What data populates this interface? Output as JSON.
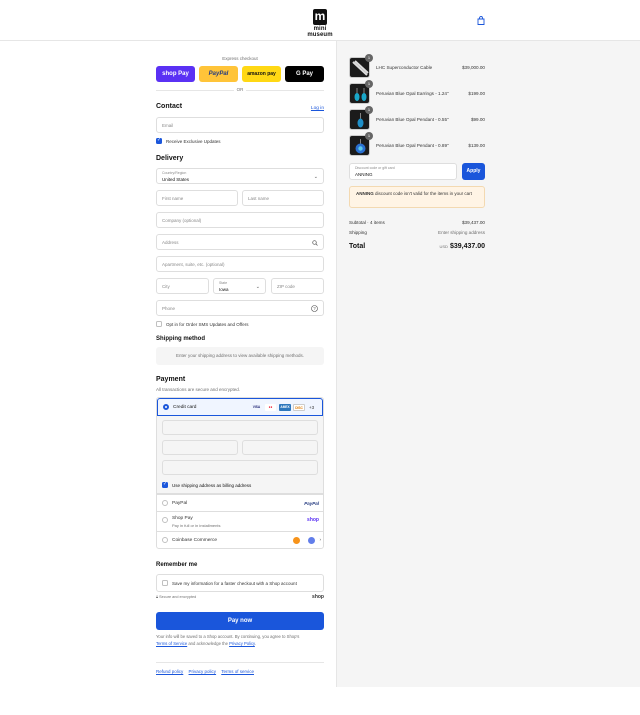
{
  "header": {
    "logo_text": "mini museum"
  },
  "express": {
    "label": "Express checkout",
    "shoppay": "shop Pay",
    "paypal": "PayPal",
    "amazon": "amazon pay",
    "gpay": "G Pay",
    "or": "OR"
  },
  "contact": {
    "title": "Contact",
    "login": "Log in",
    "email_placeholder": "Email",
    "updates_label": "Receive Exclusive Updates"
  },
  "delivery": {
    "title": "Delivery",
    "country_label": "Country/Region",
    "country_value": "United States",
    "first_name": "First name",
    "last_name": "Last name",
    "company": "Company (optional)",
    "address": "Address",
    "apartment": "Apartment, suite, etc. (optional)",
    "city": "City",
    "state_label": "State",
    "state_value": "Iowa",
    "zip": "ZIP code",
    "phone": "Phone",
    "sms_label": "Opt in for Order SMS Updates and Offers"
  },
  "shipping_method": {
    "title": "Shipping method",
    "message": "Enter your shipping address to view available shipping methods."
  },
  "payment": {
    "title": "Payment",
    "subtitle": "All transactions are secure and encrypted.",
    "credit_card": "Credit card",
    "cards": [
      "VISA",
      "MC",
      "AMEX",
      "DISC"
    ],
    "more_cards": "+3",
    "billing_label": "Use shipping address as billing address",
    "paypal": "PayPal",
    "paypal_logo": "PayPal",
    "shop_pay": "Shop Pay",
    "shop_pay_sub": "Pay in full or in installments",
    "shop_logo": "shop",
    "coinbase": "Coinbase Commerce"
  },
  "remember": {
    "title": "Remember me",
    "save_label": "Save my information for a faster checkout with a Shop account",
    "secure": "Secure and encrypted",
    "shop": "shop"
  },
  "pay_now": "Pay now",
  "legal": {
    "line1": "Your info will be saved to a Shop account. By continuing, you agree to Shop's",
    "tos": "Terms of Service",
    "and": " and acknowledge the ",
    "privacy": "Privacy Policy",
    "end": "."
  },
  "footer": {
    "refund": "Refund policy",
    "privacy": "Privacy policy",
    "terms": "Terms of service"
  },
  "cart": {
    "items": [
      {
        "name": "LHC Superconductor Cable",
        "price": "$39,000.00",
        "qty": "1"
      },
      {
        "name": "Peruvian Blue Opal Earrings - 1.24\"",
        "price": "$199.00",
        "qty": "1"
      },
      {
        "name": "Peruvian Blue Opal Pendant - 0.55\"",
        "price": "$99.00",
        "qty": "1"
      },
      {
        "name": "Peruvian Blue Opal Pendant - 0.89\"",
        "price": "$139.00",
        "qty": "1"
      }
    ],
    "discount_label": "Discount code or gift card",
    "discount_value": "ANNING",
    "apply": "Apply",
    "warning_code": "ANNING",
    "warning_text": " discount code isn't valid for the items in your cart",
    "subtotal_label": "Subtotal · 4 items",
    "subtotal_value": "$39,437.00",
    "shipping_label": "Shipping",
    "shipping_value": "Enter shipping address",
    "total_label": "Total",
    "currency": "USD",
    "total_value": "$39,437.00"
  },
  "colors": {
    "accent": "#1a56db",
    "shoppay": "#5a31f4",
    "paypal": "#ffc439",
    "amazon": "#ffd814"
  }
}
